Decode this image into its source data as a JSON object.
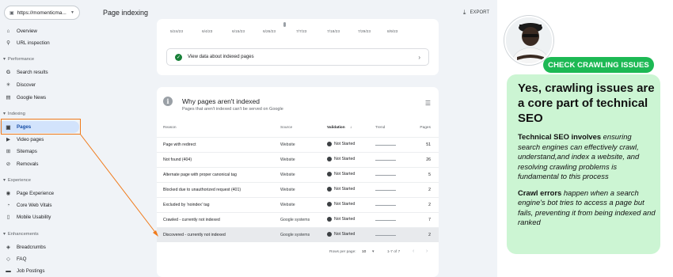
{
  "app": {
    "property": "https://momenticma...",
    "page_title": "Page indexing",
    "export_label": "EXPORT"
  },
  "sidebar": {
    "top_items": [
      {
        "label": "Overview",
        "icon": "home-icon"
      },
      {
        "label": "URL inspection",
        "icon": "search-icon"
      }
    ],
    "sections": [
      {
        "title": "Performance",
        "items": [
          {
            "label": "Search results",
            "icon": "google-g-icon"
          },
          {
            "label": "Discover",
            "icon": "asterisk-icon"
          },
          {
            "label": "Google News",
            "icon": "news-icon"
          }
        ]
      },
      {
        "title": "Indexing",
        "items": [
          {
            "label": "Pages",
            "icon": "pages-icon",
            "active": true
          },
          {
            "label": "Video pages",
            "icon": "video-icon"
          },
          {
            "label": "Sitemaps",
            "icon": "sitemap-icon"
          },
          {
            "label": "Removals",
            "icon": "removals-icon"
          }
        ]
      },
      {
        "title": "Experience",
        "items": [
          {
            "label": "Page Experience",
            "icon": "experience-icon"
          },
          {
            "label": "Core Web Vitals",
            "icon": "gauge-icon"
          },
          {
            "label": "Mobile Usability",
            "icon": "mobile-icon"
          }
        ]
      },
      {
        "title": "Enhancements",
        "items": [
          {
            "label": "Breadcrumbs",
            "icon": "layers-icon"
          },
          {
            "label": "FAQ",
            "icon": "faq-icon"
          },
          {
            "label": "Job Postings",
            "icon": "briefcase-icon"
          }
        ]
      }
    ]
  },
  "timeline": {
    "dates": [
      "5/24/23",
      "6/4/23",
      "6/15/23",
      "6/26/23",
      "7/7/23",
      "7/18/23",
      "7/29/23",
      "8/9/23"
    ],
    "view_link": "View data about indexed pages"
  },
  "why_table": {
    "title": "Why pages aren't indexed",
    "subtitle": "Pages that aren't indexed can't be served on Google",
    "headers": {
      "reason": "Reason",
      "source": "Source",
      "validation": "Validation",
      "trend": "Trend",
      "pages": "Pages"
    },
    "rows": [
      {
        "reason": "Page with redirect",
        "source": "Website",
        "validation": "Not Started",
        "pages": "51"
      },
      {
        "reason": "Not found (404)",
        "source": "Website",
        "validation": "Not Started",
        "pages": "26"
      },
      {
        "reason": "Alternate page with proper canonical tag",
        "source": "Website",
        "validation": "Not Started",
        "pages": "5"
      },
      {
        "reason": "Blocked due to unauthorized request (401)",
        "source": "Website",
        "validation": "Not Started",
        "pages": "2"
      },
      {
        "reason": "Excluded by 'noindex' tag",
        "source": "Website",
        "validation": "Not Started",
        "pages": "2"
      },
      {
        "reason": "Crawled - currently not indexed",
        "source": "Google systems",
        "validation": "Not Started",
        "pages": "7"
      },
      {
        "reason": "Discovered - currently not indexed",
        "source": "Google systems",
        "validation": "Not Started",
        "pages": "2"
      }
    ],
    "pager": {
      "rows_label": "Rows per page:",
      "rows_value": "10",
      "range": "1-7 of 7"
    }
  },
  "panel": {
    "tag": "CHECK CRAWLING ISSUES",
    "headline": "Yes, crawling issues are a core part of technical SEO",
    "p1_bold": "Technical SEO involves",
    "p1_rest": " ensuring search engines can effectively crawl, understand,and index a website, and resolving crawling problems is fundamental to this process",
    "p2_bold": "Crawl errors",
    "p2_rest": " happen when a search engine's bot tries to access a page but fails, preventing it from being indexed and ranked"
  },
  "colors": {
    "accent_orange": "#f07a1a",
    "tag_green": "#1db954",
    "card_green": "#ccf5d3",
    "sidebar_active": "#d2e3fc"
  }
}
